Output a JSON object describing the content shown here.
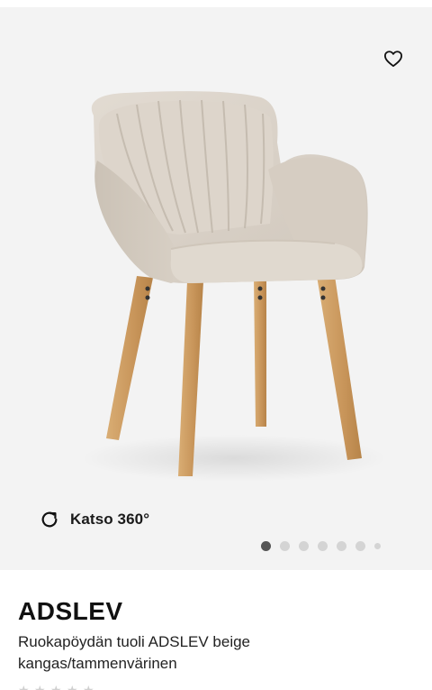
{
  "product": {
    "name": "ADSLEV",
    "description": "Ruokapöydän tuoli ADSLEV beige kangas/tammenvärinen"
  },
  "gallery": {
    "view360_label": "Katso 360°",
    "image_count": 7,
    "active_index": 0
  },
  "icons": {
    "favorite": "heart-outline-icon",
    "rotate": "rotate-icon"
  },
  "rating": {
    "stars": 0,
    "max_stars": 5
  },
  "colors": {
    "gallery_bg": "#f3f3f3",
    "fabric": "#d9d1c8",
    "wood": "#c99a62",
    "active_dot": "#555555",
    "inactive_dot": "#d4d4d4"
  }
}
